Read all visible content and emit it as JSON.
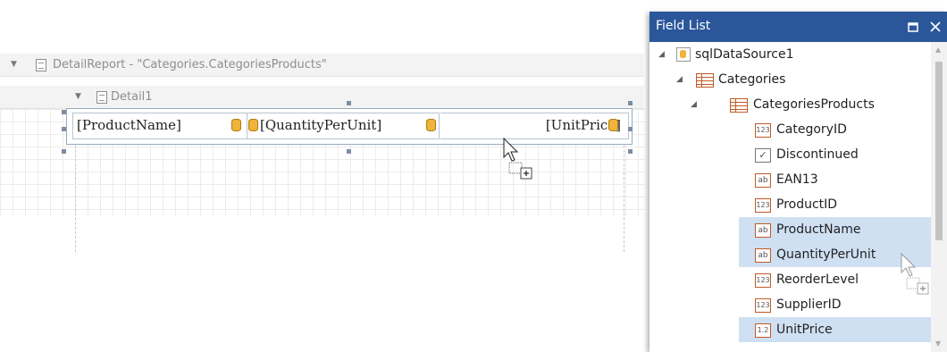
{
  "designer": {
    "detail_report_label": "DetailReport - \"Categories.CategoriesProducts\"",
    "detail_band_label": "Detail1",
    "cells": [
      "[ProductName]",
      "[QuantityPerUnit]",
      "[UnitPrice]"
    ]
  },
  "field_list": {
    "title": "Field List",
    "datasource": "sqlDataSource1",
    "table": "Categories",
    "relation": "CategoriesProducts",
    "fields": [
      {
        "type": "123",
        "name": "CategoryID",
        "selected": false
      },
      {
        "type": "check",
        "name": "Discontinued",
        "selected": false
      },
      {
        "type": "ab",
        "name": "EAN13",
        "selected": false
      },
      {
        "type": "123",
        "name": "ProductID",
        "selected": false
      },
      {
        "type": "ab",
        "name": "ProductName",
        "selected": true
      },
      {
        "type": "ab",
        "name": "QuantityPerUnit",
        "selected": true
      },
      {
        "type": "123",
        "name": "ReorderLevel",
        "selected": false
      },
      {
        "type": "123",
        "name": "SupplierID",
        "selected": false
      },
      {
        "type": "1.2",
        "name": "UnitPrice",
        "selected": true
      }
    ]
  },
  "colors": {
    "titlebar": "#2b579a",
    "selection": "#cfe0f3"
  }
}
